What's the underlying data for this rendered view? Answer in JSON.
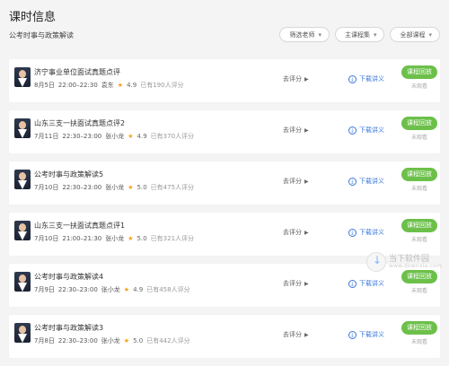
{
  "page": {
    "title": "课时信息",
    "subtitle": "公考时事与政策解读"
  },
  "filters": {
    "teacher": "筛选老师",
    "course_set": "主课程集",
    "all_courses": "全部课程"
  },
  "actions": {
    "review": "去评分",
    "download": "下载讲义",
    "replay": "课程回放",
    "not_viewed": "未观看"
  },
  "courses": [
    {
      "title": "济宁事业单位面试真题点评",
      "date": "8月5日",
      "time": "22:00–22:30",
      "teacher": "袁东",
      "rating": "4.9",
      "rating_count": "已有190人评分"
    },
    {
      "title": "山东三支一扶面试真题点评2",
      "date": "7月11日",
      "time": "22:30–23:00",
      "teacher": "张小龙",
      "rating": "4.9",
      "rating_count": "已有370人评分"
    },
    {
      "title": "公考时事与政策解读5",
      "date": "7月10日",
      "time": "22:30–23:00",
      "teacher": "张小龙",
      "rating": "5.0",
      "rating_count": "已有475人评分"
    },
    {
      "title": "山东三支一扶面试真题点评1",
      "date": "7月10日",
      "time": "21:00–21:30",
      "teacher": "张小龙",
      "rating": "5.0",
      "rating_count": "已有321人评分"
    },
    {
      "title": "公考时事与政策解读4",
      "date": "7月9日",
      "time": "22:30–23:00",
      "teacher": "张小龙",
      "rating": "4.9",
      "rating_count": "已有458人评分"
    },
    {
      "title": "公考时事与政策解读3",
      "date": "7月8日",
      "time": "22:30–23:00",
      "teacher": "张小龙",
      "rating": "5.0",
      "rating_count": "已有442人评分"
    }
  ],
  "watermark": {
    "main": "当下软件园",
    "sub": "www.downxia.com"
  },
  "colors": {
    "accent_green": "#6cc04a",
    "link_blue": "#3c78d8",
    "star": "#f4a01a"
  }
}
